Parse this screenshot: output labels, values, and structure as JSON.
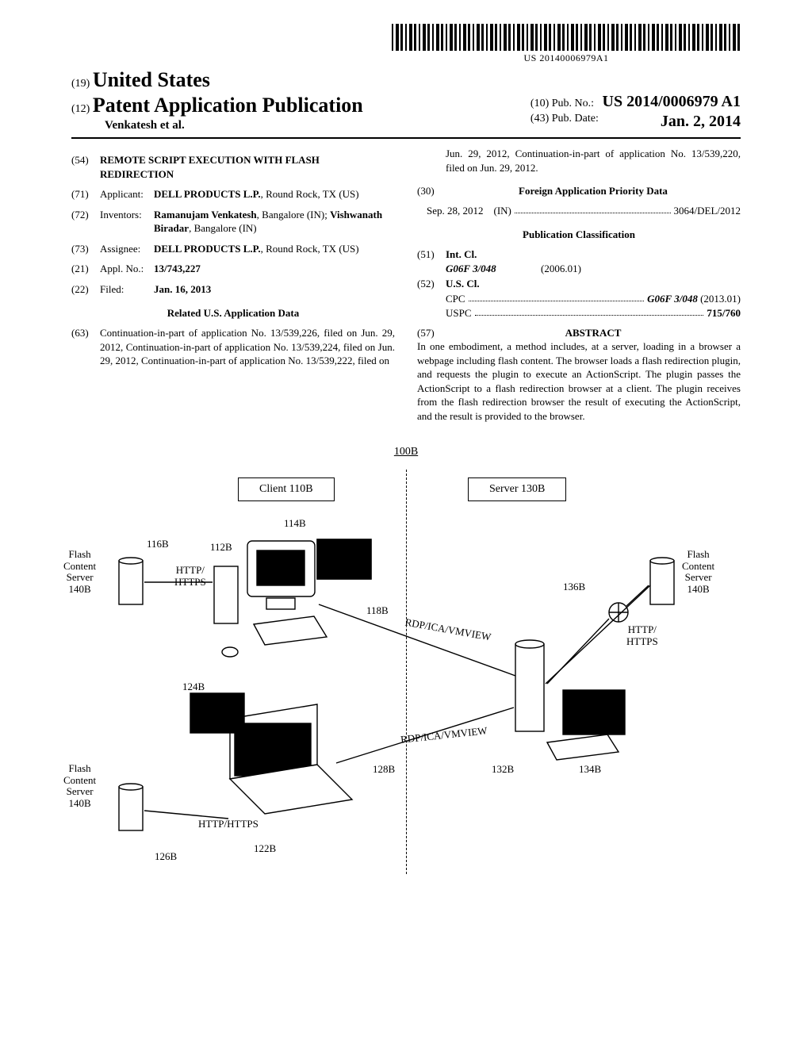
{
  "barcode_text": "US 20140006979A1",
  "header": {
    "code19": "(19)",
    "country": "United States",
    "code12": "(12)",
    "doctype": "Patent Application Publication",
    "authors": "Venkatesh et al.",
    "code10": "(10)",
    "pubno_label": "Pub. No.:",
    "pubno": "US 2014/0006979 A1",
    "code43": "(43)",
    "pubdate_label": "Pub. Date:",
    "pubdate": "Jan. 2, 2014"
  },
  "left": {
    "f54": {
      "code": "(54)",
      "text": "REMOTE SCRIPT EXECUTION WITH FLASH REDIRECTION"
    },
    "f71": {
      "code": "(71)",
      "label": "Applicant:",
      "text": "DELL PRODUCTS L.P., Round Rock, TX (US)"
    },
    "f72": {
      "code": "(72)",
      "label": "Inventors:",
      "text": "Ramanujam Venkatesh, Bangalore (IN); Vishwanath Biradar, Bangalore (IN)"
    },
    "f73": {
      "code": "(73)",
      "label": "Assignee:",
      "text": "DELL PRODUCTS L.P., Round Rock, TX (US)"
    },
    "f21": {
      "code": "(21)",
      "label": "Appl. No.:",
      "text": "13/743,227"
    },
    "f22": {
      "code": "(22)",
      "label": "Filed:",
      "text": "Jan. 16, 2013"
    },
    "related_head": "Related U.S. Application Data",
    "f63": {
      "code": "(63)",
      "text": "Continuation-in-part of application No. 13/539,226, filed on Jun. 29, 2012, Continuation-in-part of application No. 13/539,224, filed on Jun. 29, 2012, Continuation-in-part of application No. 13/539,222, filed on"
    }
  },
  "right": {
    "cont": "Jun. 29, 2012, Continuation-in-part of application No. 13/539,220, filed on Jun. 29, 2012.",
    "f30_code": "(30)",
    "f30_head": "Foreign Application Priority Data",
    "foreign_date": "Sep. 28, 2012",
    "foreign_cc": "(IN)",
    "foreign_num": "3064/DEL/2012",
    "pubclass_head": "Publication Classification",
    "f51_code": "(51)",
    "intcl_label": "Int. Cl.",
    "intcl_class": "G06F 3/048",
    "intcl_date": "(2006.01)",
    "f52_code": "(52)",
    "uscl_label": "U.S. Cl.",
    "cpc_label": "CPC",
    "cpc_val": "G06F 3/048 (2013.01)",
    "uspc_label": "USPC",
    "uspc_val": "715/760",
    "f57_code": "(57)",
    "abstract_head": "ABSTRACT",
    "abstract": "In one embodiment, a method includes, at a server, loading in a browser a webpage including flash content. The browser loads a flash redirection plugin, and requests the plugin to execute an ActionScript. The plugin passes the ActionScript to a flash redirection browser at a client. The plugin receives from the flash redirection browser the result of executing the ActionScript, and the result is provided to the browser."
  },
  "figure": {
    "title": "100B",
    "client": "Client 110B",
    "server": "Server 130B",
    "fcs": "Flash\nContent\nServer\n140B",
    "http": "HTTP/\nHTTPS",
    "http2": "HTTP/HTTPS",
    "rdp": "RDP/ICA/VMVIEW",
    "r112": "112B",
    "r114": "114B",
    "r116": "116B",
    "r118": "118B",
    "r122": "122B",
    "r124": "124B",
    "r126": "126B",
    "r128": "128B",
    "r132": "132B",
    "r134": "134B",
    "r136": "136B"
  }
}
